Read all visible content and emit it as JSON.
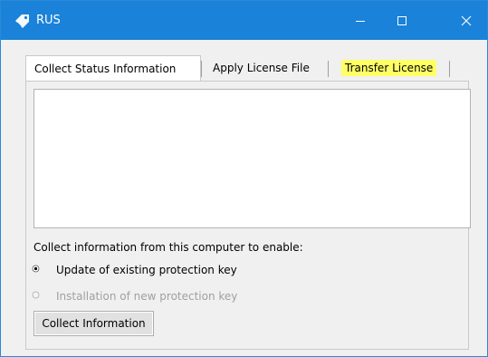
{
  "window": {
    "title": "RUS",
    "accent": "#1a82d9",
    "icons": {
      "app": "tag-key-icon",
      "minimize": "minimize-icon",
      "maximize": "maximize-icon",
      "close": "close-icon"
    }
  },
  "tabs": [
    {
      "label": "Collect Status Information",
      "selected": true
    },
    {
      "label": "Apply License File",
      "selected": false
    },
    {
      "label": "Transfer License",
      "selected": false,
      "highlight": "#ffff66"
    }
  ],
  "panel": {
    "textbox_value": "",
    "instruction": "Collect information from this computer to enable:",
    "options": [
      {
        "label": "Update of existing protection key",
        "checked": true,
        "enabled": true
      },
      {
        "label": "Installation of new protection key",
        "checked": false,
        "enabled": false
      }
    ],
    "collect_button": "Collect Information"
  }
}
